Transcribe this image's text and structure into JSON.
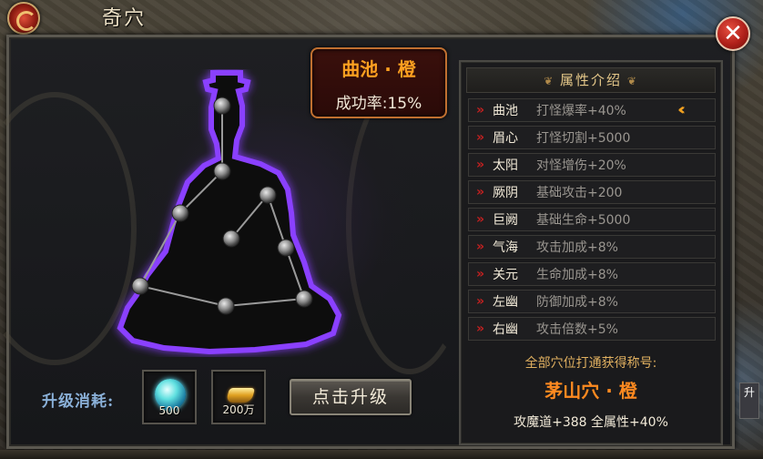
{
  "window": {
    "title": "奇穴"
  },
  "point_card": {
    "name": "曲池 · 橙",
    "success_rate": "成功率:15%"
  },
  "attr_panel": {
    "header": "属性介绍",
    "rows": [
      {
        "point": "曲池",
        "effect": "打怪爆率+40%",
        "selected": true
      },
      {
        "point": "眉心",
        "effect": "打怪切割+5000"
      },
      {
        "point": "太阳",
        "effect": "对怪增伤+20%"
      },
      {
        "point": "厥阴",
        "effect": "基础攻击+200"
      },
      {
        "point": "巨阙",
        "effect": "基础生命+5000"
      },
      {
        "point": "气海",
        "effect": "攻击加成+8%"
      },
      {
        "point": "关元",
        "effect": "生命加成+8%"
      },
      {
        "point": "左幽",
        "effect": "防御加成+8%"
      },
      {
        "point": "右幽",
        "effect": "攻击倍数+5%"
      }
    ],
    "reward_label": "全部穴位打通获得称号:",
    "reward_title": "茅山穴 · 橙",
    "reward_stats": "攻魔道+388 全属性+40%"
  },
  "cost": {
    "label": "升级消耗:",
    "items": [
      {
        "icon": "spirit-orb-icon",
        "qty": "500"
      },
      {
        "icon": "gold-ingot-icon",
        "qty": "200万"
      }
    ]
  },
  "buttons": {
    "upgrade": "点击升级",
    "close": "✕"
  },
  "edge": {
    "label": "升"
  },
  "colors": {
    "accent_orange": "#ffa020",
    "chevron_red": "#c02020",
    "silhouette_glow": "#8a40ff"
  }
}
